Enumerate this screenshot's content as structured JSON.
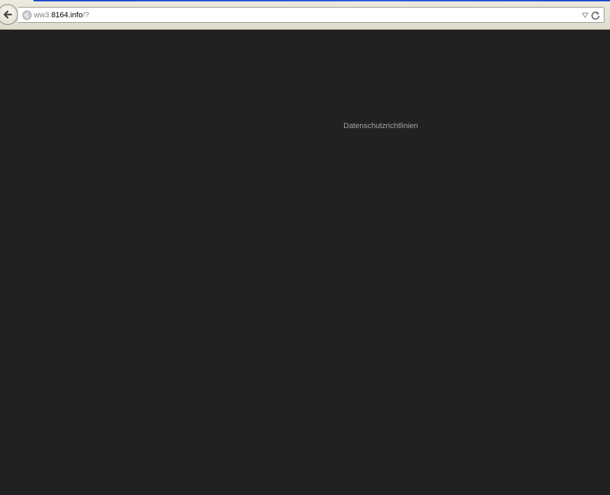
{
  "browser": {
    "url": {
      "prefix": "ww3.",
      "host": "8164.info",
      "suffix": "/?"
    },
    "icons": {
      "back": "back-arrow-icon",
      "site": "globe-icon",
      "dropdown": "dropdown-arrow-icon",
      "reload": "reload-icon"
    }
  },
  "page": {
    "background_color": "#212121",
    "privacy_link": "Datenschutzrichtlinien"
  }
}
